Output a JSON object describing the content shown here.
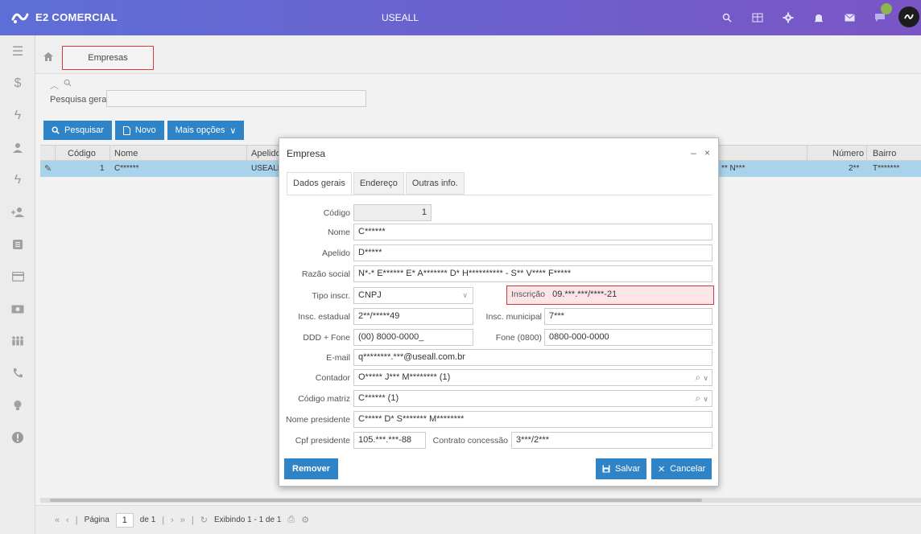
{
  "app": {
    "brand": "E2 COMERCIAL",
    "center_title": "USEALL",
    "accent": "#2f84c7",
    "header_gradient": [
      "#5d6fd6",
      "#7a55c4"
    ]
  },
  "topbar_icons": [
    "search-icon",
    "grid-icon",
    "gear-icon",
    "bell-icon",
    "mail-icon",
    "chat-icon"
  ],
  "sidebar": {
    "items": [
      "menu-icon",
      "dollar-icon",
      "bolt-icon",
      "user-icon",
      "bolt-icon",
      "add-user-icon",
      "list-icon",
      "card-icon",
      "money-icon",
      "people-icon",
      "phone-icon",
      "bulb-icon",
      "alert-icon"
    ]
  },
  "breadcrumb": {
    "current": "Empresas"
  },
  "search": {
    "label": "Pesquisa geral",
    "value": ""
  },
  "toolbar": {
    "pesquisar": "Pesquisar",
    "novo": "Novo",
    "mais_opcoes": "Mais opções"
  },
  "grid": {
    "headers": {
      "codigo": "Código",
      "nome": "Nome",
      "apelido": "Apelido",
      "numero": "Número",
      "bairro": "Bairro"
    },
    "row": {
      "codigo": "1",
      "nome": "C******",
      "apelido": "USEALL",
      "extra": "** N***",
      "numero": "2**",
      "bairro": "T*******"
    }
  },
  "pager": {
    "pagina": "Página",
    "page": "1",
    "de": "de 1",
    "exibindo": "Exibindo 1 - 1 de 1"
  },
  "modal": {
    "title": "Empresa",
    "tabs": [
      "Dados gerais",
      "Endereço",
      "Outras info."
    ],
    "fields": {
      "codigo": {
        "label": "Código",
        "value": "1"
      },
      "nome": {
        "label": "Nome",
        "value": "C******"
      },
      "apelido": {
        "label": "Apelido",
        "value": "D*****"
      },
      "razao_social": {
        "label": "Razão social",
        "value": "N*-* E****** E* A******* D* H********** - S** V**** F*****"
      },
      "tipo_inscr": {
        "label": "Tipo inscr.",
        "value": "CNPJ"
      },
      "inscricao": {
        "label": "Inscrição",
        "value": "09.***.***/****-21"
      },
      "insc_estadual": {
        "label": "Insc. estadual",
        "value": "2**/*****49"
      },
      "insc_municipal": {
        "label": "Insc. municipal",
        "value": "7***"
      },
      "ddd_fone": {
        "label": "DDD + Fone",
        "value": "(00) 8000-0000_"
      },
      "fone_0800": {
        "label": "Fone (0800)",
        "value": "0800-000-0000"
      },
      "email": {
        "label": "E-mail",
        "value": "q********.***@useall.com.br"
      },
      "contador": {
        "label": "Contador",
        "value": "O***** J*** M******** (1)"
      },
      "codigo_matriz": {
        "label": "Código matriz",
        "value": "C****** (1)"
      },
      "nome_presidente": {
        "label": "Nome presidente",
        "value": "C***** D* S******* M********"
      },
      "cpf_presidente": {
        "label": "Cpf presidente",
        "value": "105.***.***-88"
      },
      "contrato_concessao": {
        "label": "Contrato concessão",
        "value": "3***/2***"
      }
    },
    "buttons": {
      "remover": "Remover",
      "salvar": "Salvar",
      "cancelar": "Cancelar"
    }
  }
}
